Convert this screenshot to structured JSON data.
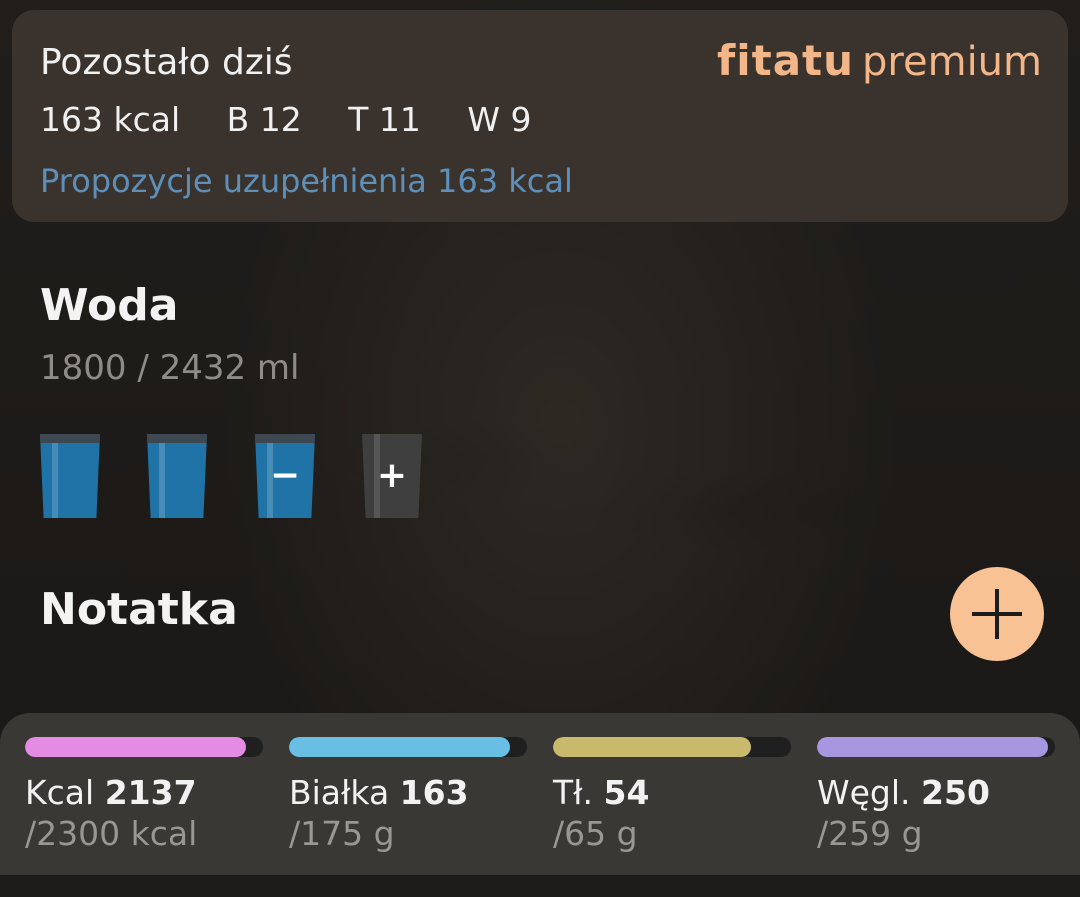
{
  "remaining": {
    "title": "Pozostało dziś",
    "kcal": "163 kcal",
    "protein": "B 12",
    "fat": "T 11",
    "carbs": "W 9",
    "suggestion_link": "Propozycje uzupełnienia 163 kcal"
  },
  "brand": {
    "logo": "fitatu",
    "tier": "premium",
    "color": "#f2b689"
  },
  "water": {
    "title": "Woda",
    "amount": "1800 / 2432 ml",
    "glasses": [
      {
        "state": "full",
        "sign": ""
      },
      {
        "state": "full",
        "sign": ""
      },
      {
        "state": "full",
        "sign": "−"
      },
      {
        "state": "empty",
        "sign": "+"
      }
    ]
  },
  "note": {
    "title": "Notatka",
    "add_icon": "plus-icon"
  },
  "macros": [
    {
      "name": "Kcal",
      "value": "2137",
      "goal": "/2300 kcal",
      "progress": 0.93,
      "color": "#e48be3"
    },
    {
      "name": "Białka",
      "value": "163",
      "goal": "/175 g",
      "progress": 0.93,
      "color": "#69bfe3"
    },
    {
      "name": "Tł.",
      "value": "54",
      "goal": "/65 g",
      "progress": 0.83,
      "color": "#c8b96d"
    },
    {
      "name": "Węgl.",
      "value": "250",
      "goal": "/259 g",
      "progress": 0.97,
      "color": "#a797e1"
    }
  ]
}
